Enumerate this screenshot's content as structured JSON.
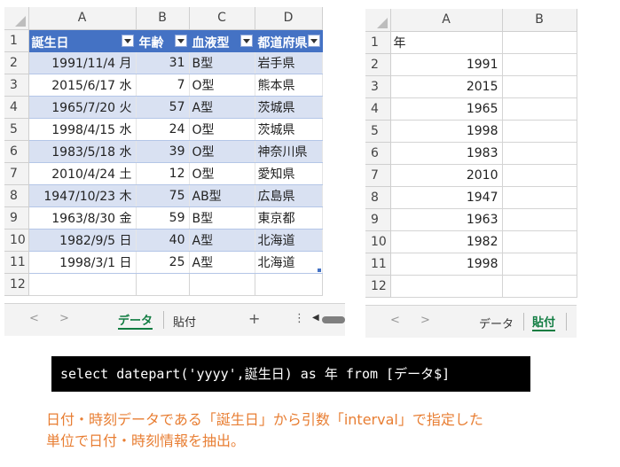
{
  "left_sheet": {
    "col_headers": [
      "A",
      "B",
      "C",
      "D"
    ],
    "row_numbers": [
      "1",
      "2",
      "3",
      "4",
      "5",
      "6",
      "7",
      "8",
      "9",
      "10",
      "11",
      "12"
    ],
    "table_headers": [
      "誕生日",
      "年齢",
      "血液型",
      "都道府県"
    ],
    "rows": [
      [
        "1991/11/4 月",
        "31",
        "B型",
        "岩手県"
      ],
      [
        "2015/6/17 水",
        "7",
        "O型",
        "熊本県"
      ],
      [
        "1965/7/20 火",
        "57",
        "A型",
        "茨城県"
      ],
      [
        "1998/4/15 水",
        "24",
        "O型",
        "茨城県"
      ],
      [
        "1983/5/18 水",
        "39",
        "O型",
        "神奈川県"
      ],
      [
        "2010/4/24 土",
        "12",
        "O型",
        "愛知県"
      ],
      [
        "1947/10/23 木",
        "75",
        "AB型",
        "広島県"
      ],
      [
        "1963/8/30 金",
        "59",
        "B型",
        "東京都"
      ],
      [
        "1982/9/5 日",
        "40",
        "A型",
        "北海道"
      ],
      [
        "1998/3/1 日",
        "25",
        "A型",
        "北海道"
      ]
    ],
    "tabs": [
      "データ",
      "貼付"
    ],
    "active_tab": "データ",
    "nav_prev": "<",
    "nav_next": ">",
    "add_sheet": "+",
    "more": "⋮",
    "scroll_left": "◀"
  },
  "right_sheet": {
    "col_headers": [
      "A",
      "B"
    ],
    "row_numbers": [
      "1",
      "2",
      "3",
      "4",
      "5",
      "6",
      "7",
      "8",
      "9",
      "10",
      "11",
      "12"
    ],
    "header": "年",
    "values": [
      "1991",
      "2015",
      "1965",
      "1998",
      "1983",
      "2010",
      "1947",
      "1963",
      "1982",
      "1998"
    ],
    "tabs": [
      "データ",
      "貼付"
    ],
    "active_tab": "貼付",
    "nav_prev": "<",
    "nav_next": ">"
  },
  "sql": "select datepart('yyyy',誕生日) as 年 from [データ$]",
  "caption": {
    "line1": "日付・時刻データである「誕生日」から引数「interval」で指定した",
    "line2": "単位で日付・時刻情報を抽出。"
  },
  "colors": {
    "table_header": "#4472c4",
    "band": "#d9e1f2",
    "caption": "#e87e33",
    "active_tab": "#107c41"
  }
}
